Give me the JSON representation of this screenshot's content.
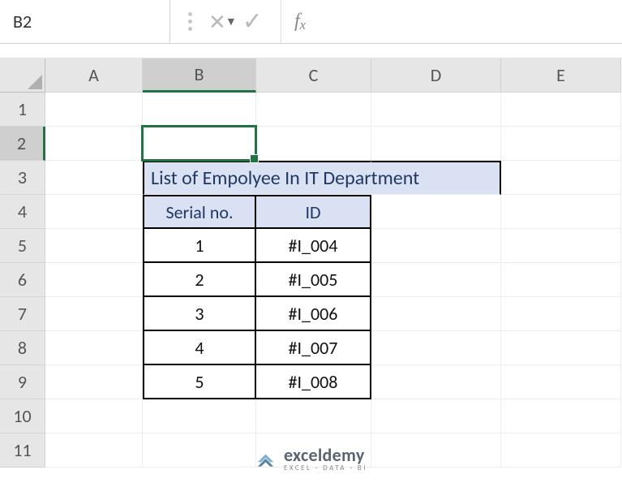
{
  "name_box": {
    "value": "B2"
  },
  "formula_bar": {
    "value": "",
    "fx_label": "fx"
  },
  "columns": [
    "A",
    "B",
    "C",
    "D",
    "E"
  ],
  "rows": [
    "1",
    "2",
    "3",
    "4",
    "5",
    "6",
    "7",
    "8",
    "9",
    "10",
    "11"
  ],
  "active_cell": {
    "col": "B",
    "row": "2"
  },
  "title": "List of Empolyee In IT Department",
  "table": {
    "head_serial": "Serial no.",
    "head_id": "ID",
    "rows": [
      {
        "serial": "1",
        "id": "#I_004"
      },
      {
        "serial": "2",
        "id": "#I_005"
      },
      {
        "serial": "3",
        "id": "#I_006"
      },
      {
        "serial": "4",
        "id": "#I_007"
      },
      {
        "serial": "5",
        "id": "#I_008"
      }
    ]
  },
  "watermark": {
    "brand": "exceldemy",
    "tagline": "EXCEL · DATA · BI"
  },
  "colors": {
    "selection": "#217346",
    "header_fill": "#d9e1f2",
    "title_text": "#203864"
  },
  "chart_data": {
    "type": "table",
    "title": "List of Empolyee In IT Department",
    "columns": [
      "Serial no.",
      "ID"
    ],
    "rows": [
      [
        "1",
        "#I_004"
      ],
      [
        "2",
        "#I_005"
      ],
      [
        "3",
        "#I_006"
      ],
      [
        "4",
        "#I_007"
      ],
      [
        "5",
        "#I_008"
      ]
    ]
  }
}
